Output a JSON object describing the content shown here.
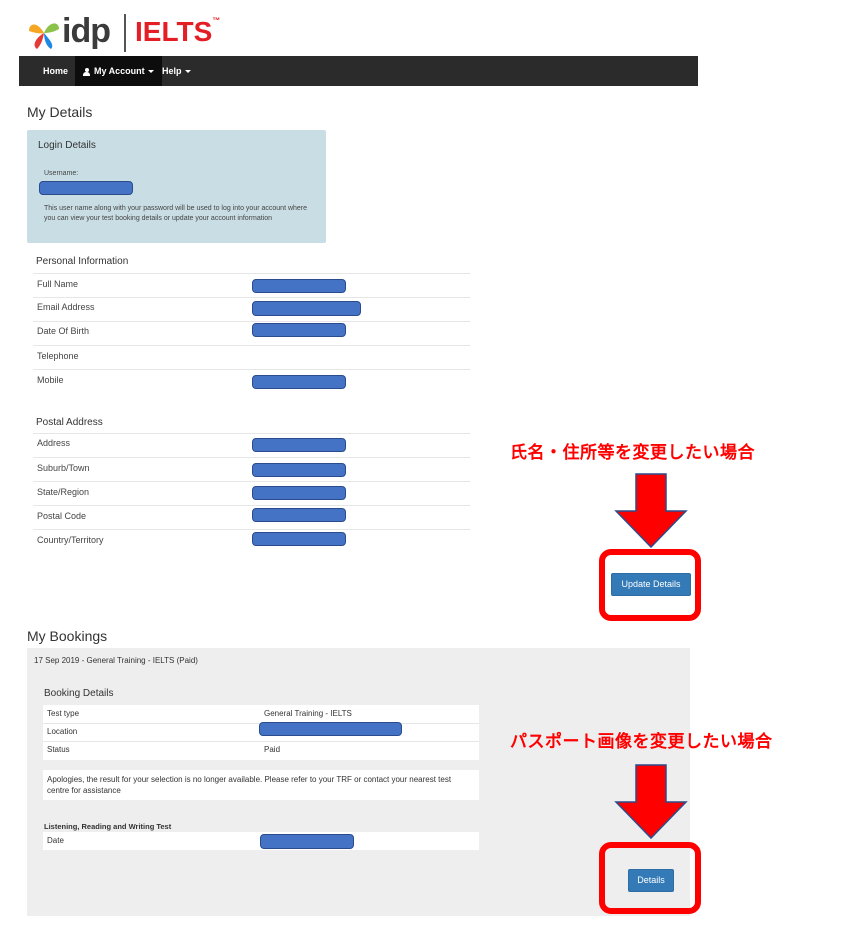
{
  "header": {
    "logo_idp": "idp",
    "logo_ielts": "IELTS",
    "logo_tm": "™"
  },
  "nav": {
    "home": "Home",
    "my_account": "My Account",
    "help": "Help"
  },
  "my_details": {
    "title": "My Details",
    "login": {
      "title": "Login Details",
      "username_label": "Username:",
      "note": "This user name along with your password will be used to log into your account where you can view your test booking details or update your account information"
    },
    "personal": {
      "title": "Personal Information",
      "rows": [
        "Full Name",
        "Email Address",
        "Date Of Birth",
        "Telephone",
        "Mobile"
      ]
    },
    "postal": {
      "title": "Postal Address",
      "rows": [
        "Address",
        "Suburb/Town",
        "State/Region",
        "Postal Code",
        "Country/Territory"
      ]
    },
    "update_button": "Update Details"
  },
  "annotations": {
    "note1": "氏名・住所等を変更したい場合",
    "note2": "パスポート画像を変更したい場合",
    "color": "#ff0000"
  },
  "my_bookings": {
    "title": "My Bookings",
    "booking_header": "17 Sep 2019 - General Training - IELTS (Paid)",
    "details_title": "Booking Details",
    "rows": [
      {
        "label": "Test type",
        "value": "General Training - IELTS"
      },
      {
        "label": "Location",
        "value": ""
      },
      {
        "label": "Status",
        "value": "Paid"
      }
    ],
    "apology": "Apologies, the result for your selection is no longer available. Please refer to your TRF or contact your nearest test centre for assistance",
    "test_title": "Listening, Reading and Writing Test",
    "date_label": "Date",
    "details_button": "Details"
  },
  "colors": {
    "navbar": "#2b2b2b",
    "login_box": "#c9dde4",
    "button": "#337ab7",
    "redaction": "#4472c4",
    "ielts_red": "#e31e24"
  }
}
